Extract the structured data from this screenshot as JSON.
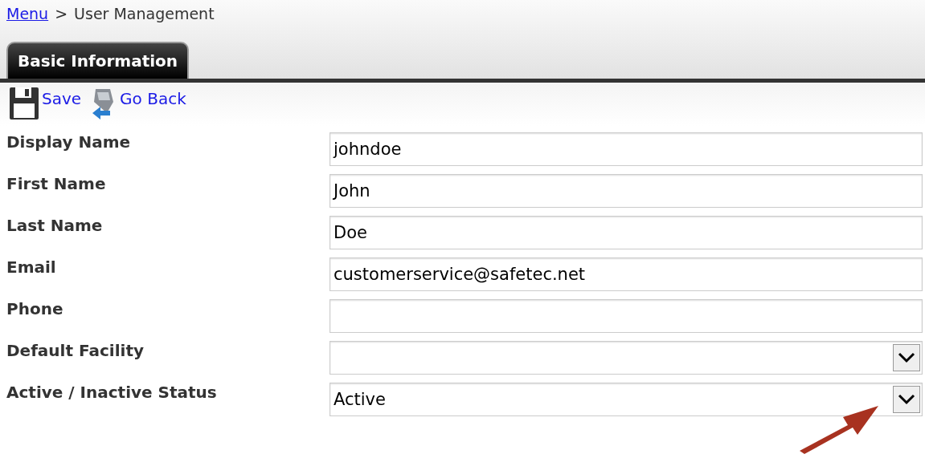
{
  "breadcrumb": {
    "link": "Menu",
    "separator": ">",
    "current": "User Management"
  },
  "tabs": [
    {
      "label": "Basic Information",
      "selected": true
    }
  ],
  "toolbar": [
    "Save",
    "Go Back"
  ],
  "fields": [
    {
      "label": "Display Name",
      "kind": "text",
      "value": "johndoe"
    },
    {
      "label": "First Name",
      "kind": "text",
      "value": "John"
    },
    {
      "label": "Last Name",
      "kind": "text",
      "value": "Doe"
    },
    {
      "label": "Email",
      "kind": "text",
      "value": "customerservice@safetec.net"
    },
    {
      "label": "Phone",
      "kind": "text"
    },
    {
      "label": "Default Facility",
      "kind": "select"
    },
    {
      "label": "Active / Inactive Status",
      "kind": "select",
      "value": "Active"
    }
  ]
}
